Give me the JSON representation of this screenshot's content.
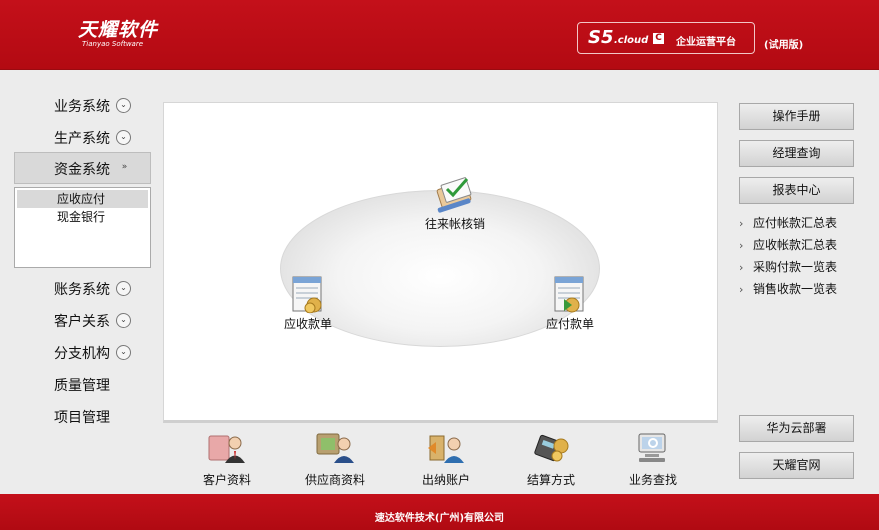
{
  "header": {
    "logo_cn": "天耀软件",
    "logo_en": "Tianyao Software",
    "product_s5": "S5",
    "product_cloud": ".cloud",
    "product_badge": "C",
    "product_name": "企业运营平台",
    "edition": "(试用版)"
  },
  "sidebar": {
    "items_top": [
      {
        "label": "业务系统",
        "chevron": "⌄"
      },
      {
        "label": "生产系统",
        "chevron": "⌄"
      }
    ],
    "active": {
      "label": "资金系统",
      "chevron": "»"
    },
    "sub_items": [
      {
        "label": "应收应付"
      },
      {
        "label": "现金银行"
      }
    ],
    "items_bottom": [
      {
        "label": "账务系统",
        "chevron": "⌄"
      },
      {
        "label": "客户关系",
        "chevron": "⌄"
      },
      {
        "label": "分支机构",
        "chevron": "⌄"
      },
      {
        "label": "质量管理"
      },
      {
        "label": "项目管理"
      }
    ]
  },
  "flow": {
    "center": "往来帐核销",
    "left": "应收款单",
    "right": "应付款单"
  },
  "bottom_bar": [
    {
      "label": "客户资料",
      "icon": "customer-icon"
    },
    {
      "label": "供应商资料",
      "icon": "supplier-icon"
    },
    {
      "label": "出纳账户",
      "icon": "cashier-icon"
    },
    {
      "label": "结算方式",
      "icon": "settlement-icon"
    },
    {
      "label": "业务查找",
      "icon": "search-icon"
    }
  ],
  "right_panel": {
    "manual": "操作手册",
    "manager_query": "经理查询",
    "report_center": "报表中心",
    "reports": [
      "应付帐款汇总表",
      "应收帐款汇总表",
      "采购付款一览表",
      "销售收款一览表"
    ],
    "huawei": "华为云部署",
    "official": "天耀官网"
  },
  "footer": {
    "company": "速达软件技术(广州)有限公司"
  },
  "colors": {
    "brand_red": "#b30a12",
    "panel_bg": "#ececec"
  }
}
